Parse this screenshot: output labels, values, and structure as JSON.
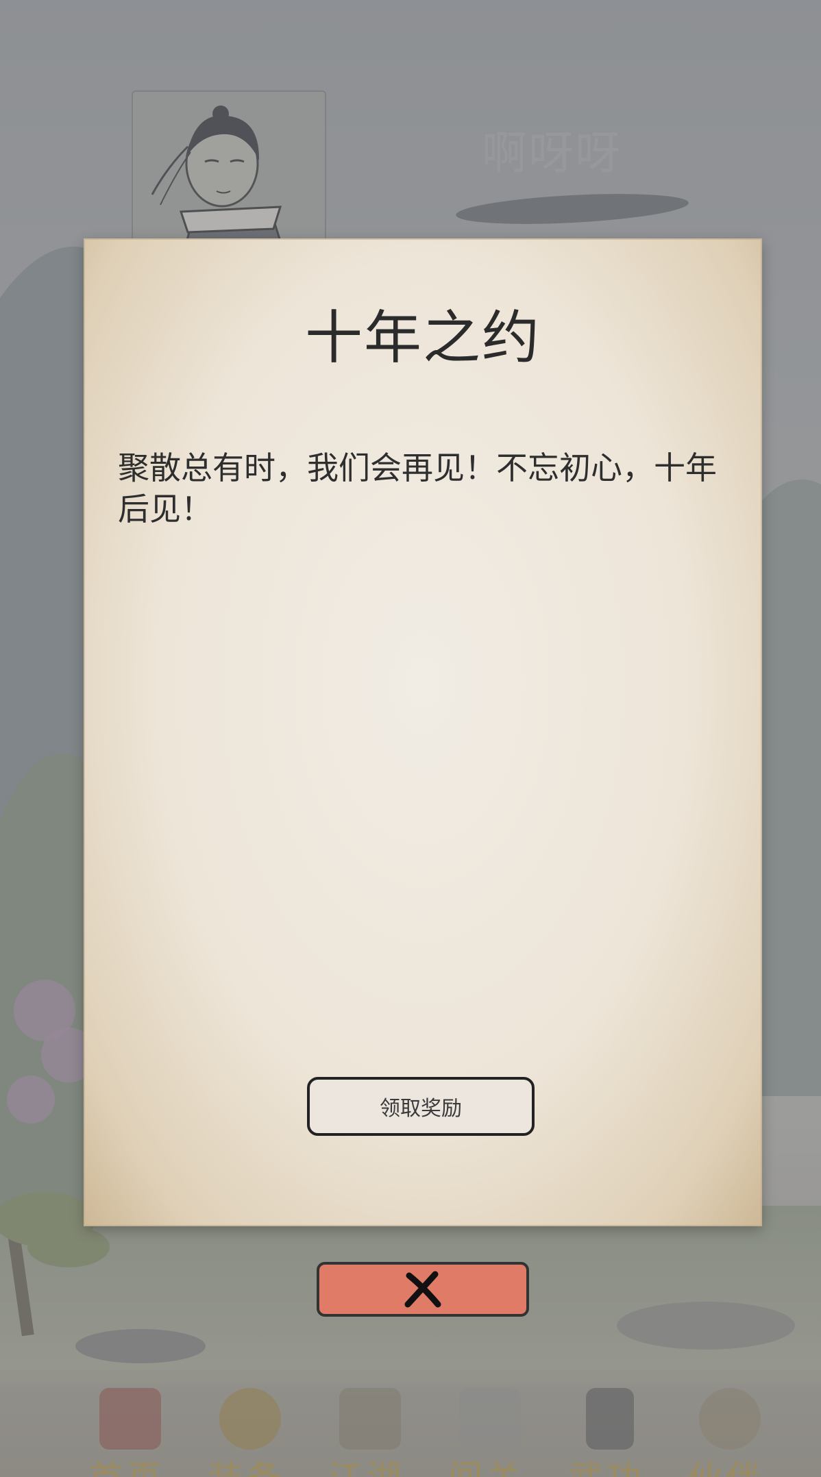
{
  "header": {
    "player_name": "啊呀呀"
  },
  "modal": {
    "title": "十年之约",
    "body": "聚散总有时，我们会再见！不忘初心，十年后见！",
    "claim_button": "领取奖励",
    "close_icon": "x-icon"
  },
  "nav": {
    "items": [
      {
        "label": "首页",
        "icon": "home-icon"
      },
      {
        "label": "装备",
        "icon": "armor-icon"
      },
      {
        "label": "江湖",
        "icon": "scroll-icon"
      },
      {
        "label": "闯关",
        "icon": "swords-icon"
      },
      {
        "label": "武功",
        "icon": "book-icon"
      },
      {
        "label": "伙伴",
        "icon": "partners-icon"
      }
    ]
  },
  "colors": {
    "close_button": "#df7b66",
    "nav_label": "#c4a13f",
    "parchment": "#ede5d8"
  }
}
